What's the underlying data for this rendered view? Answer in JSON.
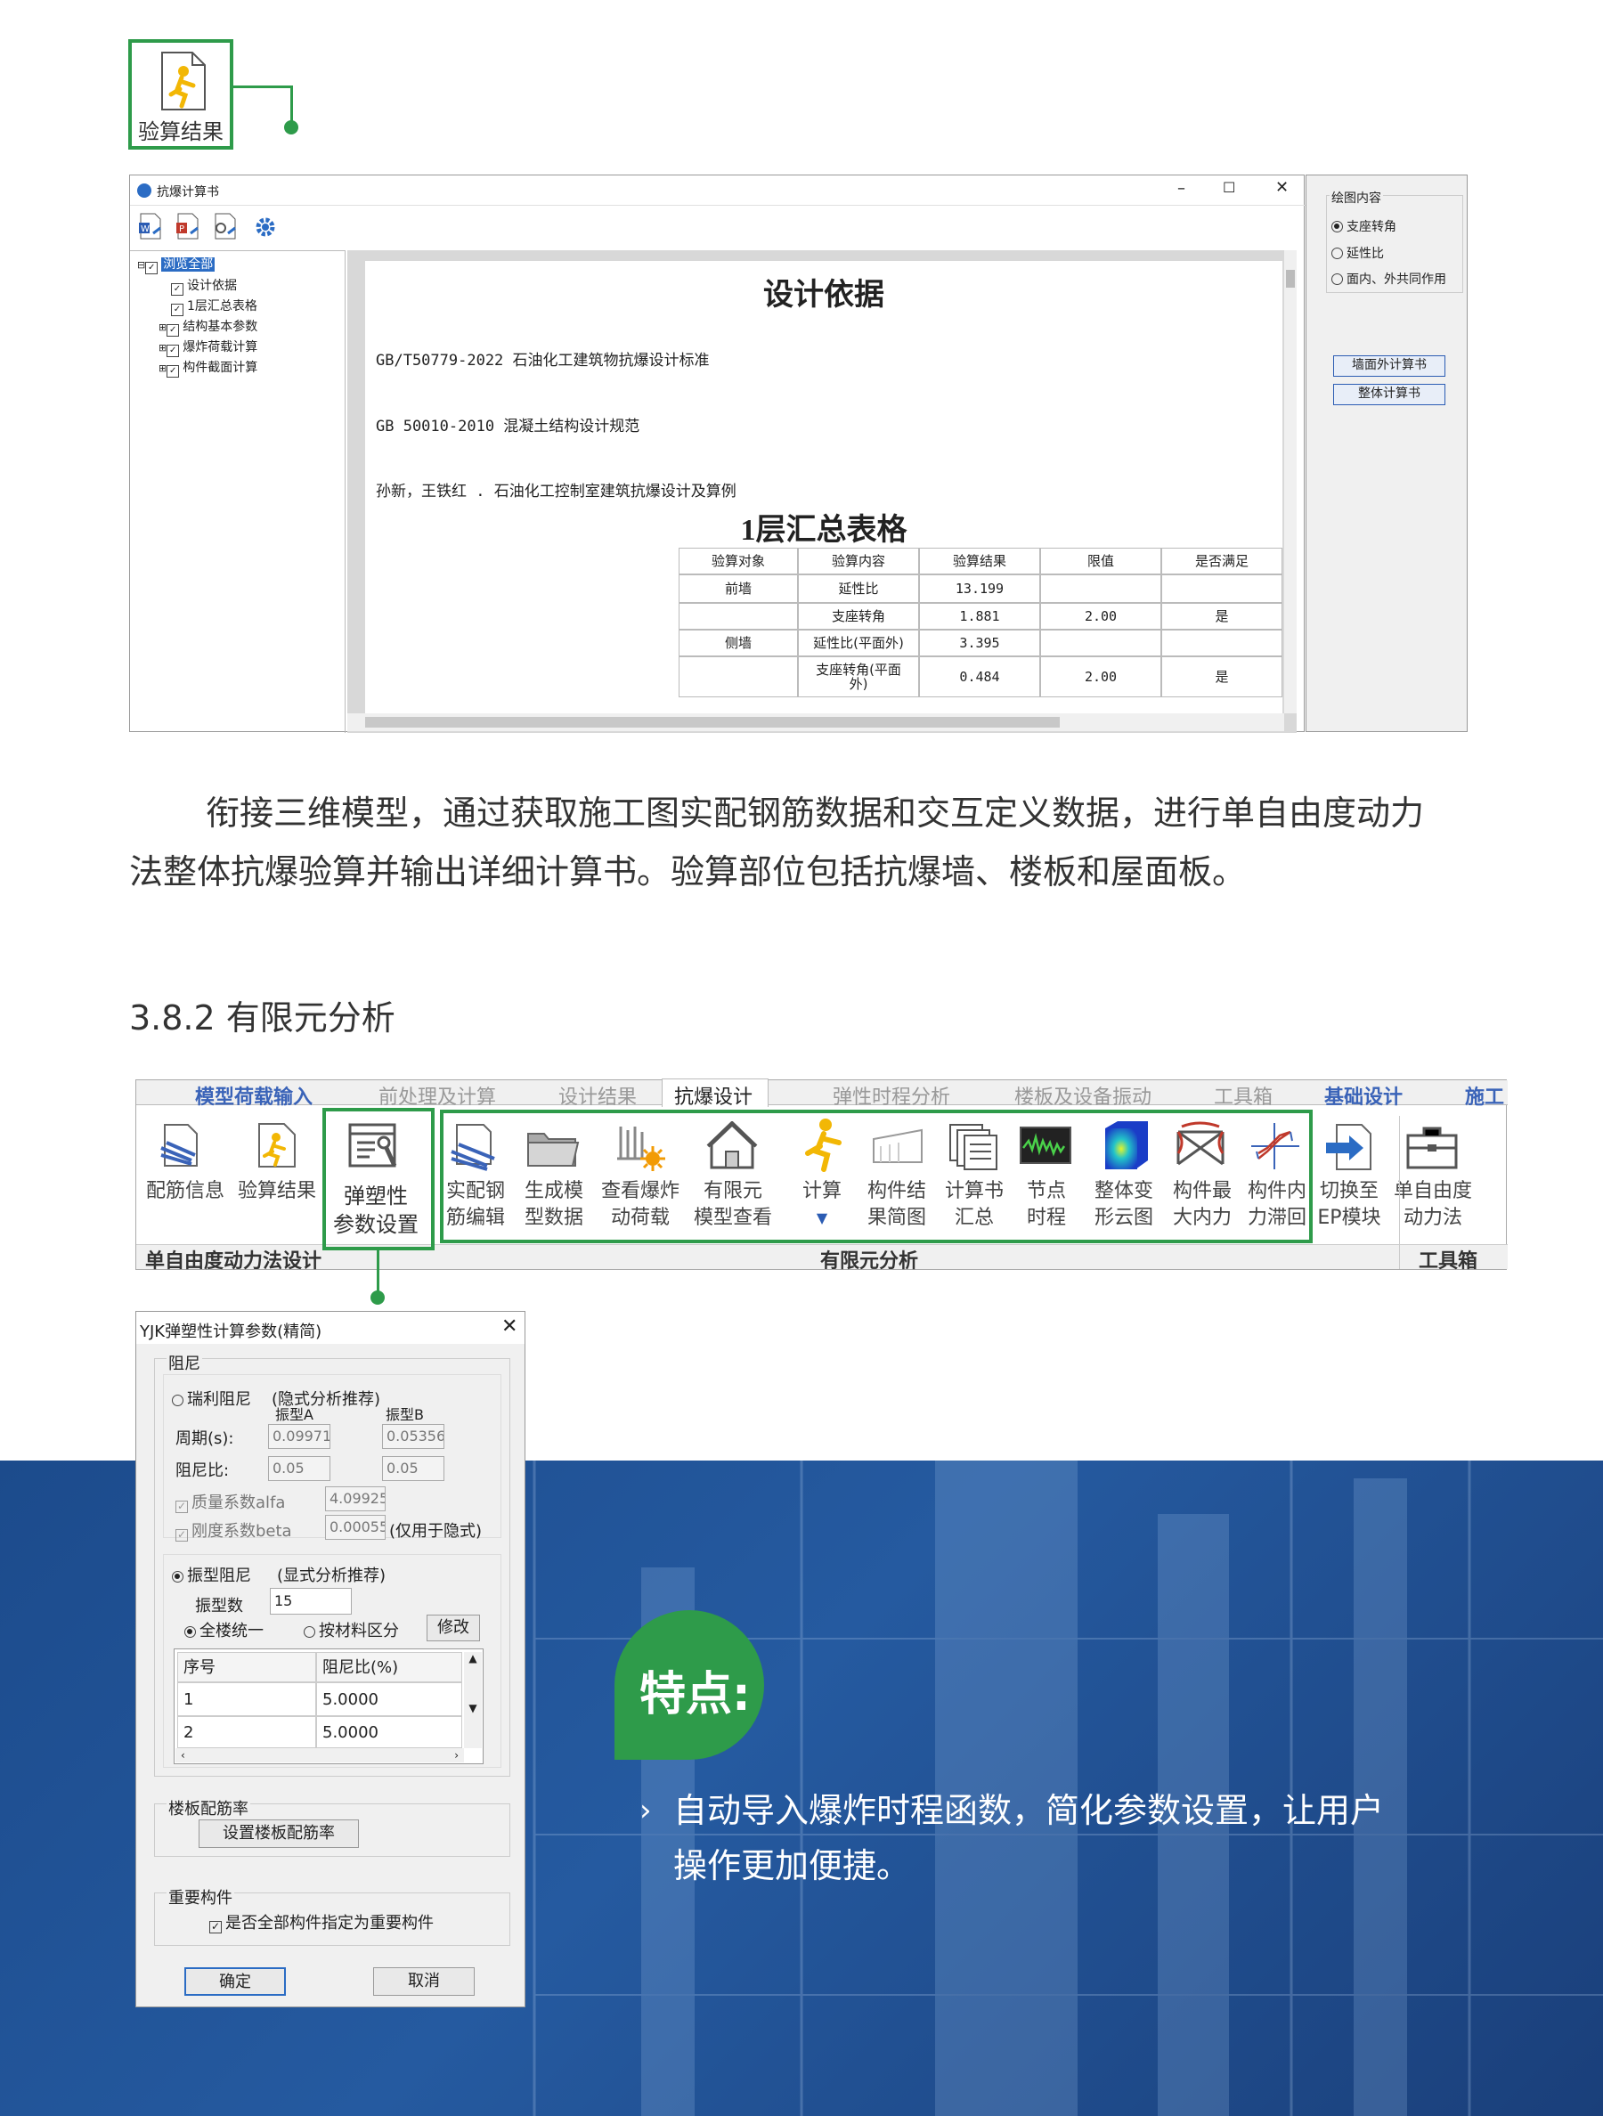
{
  "top_callout": {
    "label": "验算结果"
  },
  "window1": {
    "title": "抗爆计算书",
    "controls": [
      "–",
      "☐",
      "✕"
    ],
    "tree": {
      "root": "浏览全部",
      "items": [
        "设计依据",
        "1层汇总表格",
        "结构基本参数",
        "爆炸荷载计算",
        "构件截面计算"
      ]
    },
    "doc": {
      "heading1": "设计依据",
      "refs": [
        "GB/T50779-2022 石油化工建筑物抗爆设计标准",
        "GB 50010-2010 混凝土结构设计规范",
        "孙新，王铁红 . 石油化工控制室建筑抗爆设计及算例"
      ],
      "heading2": "1层汇总表格",
      "table_headers": [
        "验算对象",
        "验算内容",
        "验算结果",
        "限值",
        "是否满足"
      ],
      "table_rows": [
        [
          "前墙",
          "延性比",
          "13.199",
          "",
          ""
        ],
        [
          "",
          "支座转角",
          "1.881",
          "2.00",
          "是"
        ],
        [
          "侧墙",
          "延性比(平面外)",
          "3.395",
          "",
          ""
        ],
        [
          "",
          "支座转角(平面外)",
          "0.484",
          "2.00",
          "是"
        ]
      ]
    },
    "side": {
      "group_title": "绘图内容",
      "options": [
        "支座转角",
        "延性比",
        "面内、外共同作用"
      ],
      "selected": 0,
      "buttons": [
        "墙面外计算书",
        "整体计算书"
      ]
    }
  },
  "paragraph": "衔接三维模型，通过获取施工图实配钢筋数据和交互定义数据，进行单自由度动力法整体抗爆验算并输出详细计算书。验算部位包括抗爆墙、楼板和屋面板。",
  "paragraph_lines": [
    "衔接三维模型，通过获取施工图实配钢筋数据和交互定义数据，进行单自由度动力",
    "法整体抗爆验算并输出详细计算书。验算部位包括抗爆墙、楼板和屋面板。"
  ],
  "section_title": "3.8.2 有限元分析",
  "ribbon": {
    "tabs": [
      "模型荷载输入",
      "前处理及计算",
      "设计结果",
      "抗爆设计",
      "弹性时程分析",
      "楼板及设备振动",
      "工具箱",
      "基础设计",
      "施工"
    ],
    "active_tab": 3,
    "buttons": [
      {
        "label1": "配筋信息",
        "label2": ""
      },
      {
        "label1": "验算结果",
        "label2": ""
      },
      {
        "label1": "弹塑性",
        "label2": "参数设置"
      },
      {
        "label1": "实配钢",
        "label2": "筋编辑"
      },
      {
        "label1": "生成模",
        "label2": "型数据"
      },
      {
        "label1": "查看爆炸",
        "label2": "动荷载"
      },
      {
        "label1": "有限元",
        "label2": "模型查看"
      },
      {
        "label1": "计算",
        "label2": ""
      },
      {
        "label1": "构件结",
        "label2": "果简图"
      },
      {
        "label1": "计算书",
        "label2": "汇总"
      },
      {
        "label1": "节点",
        "label2": "时程"
      },
      {
        "label1": "整体变",
        "label2": "形云图"
      },
      {
        "label1": "构件最",
        "label2": "大内力"
      },
      {
        "label1": "构件内",
        "label2": "力滞回"
      },
      {
        "label1": "切换至",
        "label2": "EP模块"
      },
      {
        "label1": "单自由度",
        "label2": "动力法"
      }
    ],
    "groups": [
      "单自由度动力法设计",
      "有限元分析",
      "工具箱"
    ]
  },
  "dialog": {
    "title": "YJK弹塑性计算参数(精简)",
    "damping_group": "阻尼",
    "rayleigh_label": "瑞利阻尼",
    "rayleigh_hint": "(隐式分析推荐)",
    "modeA": "振型A",
    "modeB": "振型B",
    "period_label": "周期(s):",
    "period_a": "0.09971",
    "period_b": "0.05356",
    "ratio_label": "阻尼比:",
    "ratio_a": "0.05",
    "ratio_b": "0.05",
    "alfa_label": "质量系数alfa",
    "alfa_val": "4.09925",
    "beta_label": "刚度系数beta",
    "beta_val": "0.00055",
    "implicit_hint": "(仅用于隐式)",
    "modal_label": "振型阻尼",
    "modal_hint": "(显式分析推荐)",
    "mode_count_label": "振型数",
    "mode_count": "15",
    "uniform_label": "全楼统一",
    "by_material_label": "按材料区分",
    "modify_btn": "修改",
    "grid_headers": [
      "序号",
      "阻尼比(%)"
    ],
    "grid_rows": [
      [
        "1",
        "5.0000"
      ],
      [
        "2",
        "5.0000"
      ]
    ],
    "slab_group": "楼板配筋率",
    "slab_btn": "设置楼板配筋率",
    "important_group": "重要构件",
    "important_check": "是否全部构件指定为重要构件",
    "ok": "确定",
    "cancel": "取消"
  },
  "feature": {
    "badge": "特点:",
    "lines": [
      "自动导入爆炸时程函数，简化参数设置，让用户",
      "操作更加便捷。"
    ]
  },
  "colors": {
    "accent_green": "#2e9b4a",
    "band_blue": "#1c4b8c",
    "tab_blue": "#3a63b8"
  }
}
